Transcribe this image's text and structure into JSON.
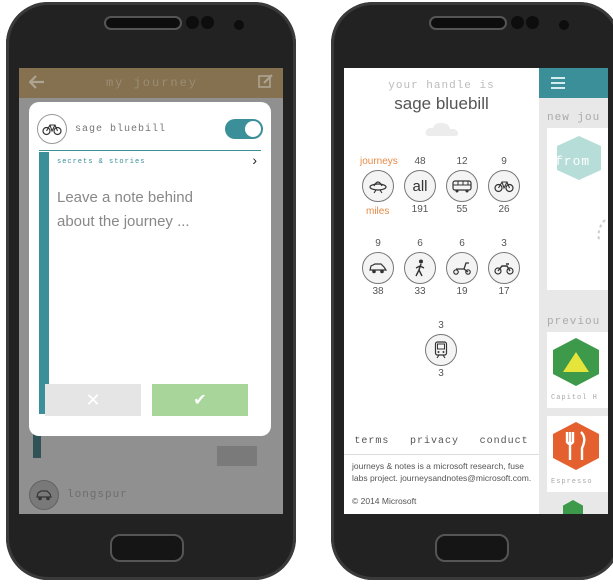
{
  "left_phone": {
    "header": {
      "title": "my journey"
    },
    "dialog": {
      "handle": "sage bluebill",
      "category": "secrets & stories",
      "note_placeholder": "Leave a note behind about the journey ...",
      "cancel_icon": "close-icon",
      "confirm_icon": "check-icon",
      "share_enabled": true
    },
    "background_item": {
      "name": "longspur"
    },
    "colors": {
      "header": "#ad8d5a",
      "accent": "#3a8f98",
      "confirm": "#a8d59a"
    }
  },
  "right_phone": {
    "drawer": {
      "handle_label": "your handle is",
      "handle": "sage bluebill",
      "journeys_label": "journeys",
      "miles_label": "miles",
      "stats": [
        {
          "mode": "alien",
          "journeys": "",
          "miles": "",
          "icon": "alien-icon"
        },
        {
          "mode": "all",
          "journeys": "48",
          "miles": "191",
          "icon": "all-icon",
          "label": "all"
        },
        {
          "mode": "bus",
          "journeys": "12",
          "miles": "55",
          "icon": "bus-icon"
        },
        {
          "mode": "bicycle",
          "journeys": "9",
          "miles": "26",
          "icon": "bicycle-icon"
        },
        {
          "mode": "car",
          "journeys": "9",
          "miles": "38",
          "icon": "car-icon"
        },
        {
          "mode": "walk",
          "journeys": "6",
          "miles": "33",
          "icon": "walk-icon"
        },
        {
          "mode": "scooter",
          "journeys": "6",
          "miles": "19",
          "icon": "scooter-icon"
        },
        {
          "mode": "motorcycle",
          "journeys": "3",
          "miles": "17",
          "icon": "motorcycle-icon"
        },
        {
          "mode": "train",
          "journeys": "3",
          "miles": "3",
          "icon": "train-icon"
        }
      ],
      "footer_links": [
        "terms",
        "privacy",
        "conduct"
      ],
      "about": "journeys & notes is a microsoft research, fuse labs project. journeysandnotes@microsoft.com.",
      "copyright": "© 2014 Microsoft"
    },
    "main": {
      "new_section_label": "new jou",
      "new_card_text": "from",
      "previous_section_label": "previou",
      "previous_items": [
        {
          "name": "Capitol H",
          "icon": "tent-icon",
          "color": "#3c9a4a"
        },
        {
          "name": "Espresso",
          "icon": "cutlery-icon",
          "color": "#e4602e"
        }
      ]
    },
    "colors": {
      "bar": "#3a8f98",
      "orange": "#e68a45"
    }
  }
}
